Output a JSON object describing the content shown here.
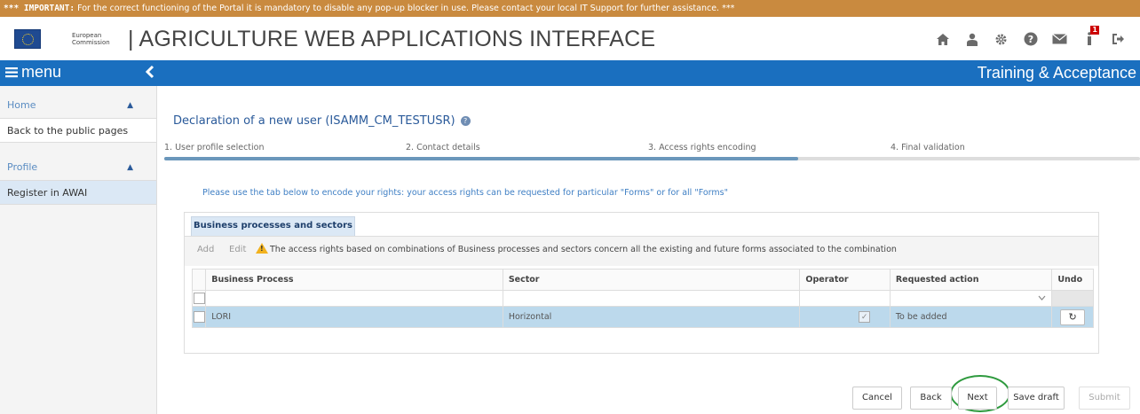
{
  "banner": {
    "label": "*** IMPORTANT:",
    "text": "For the correct functioning of the Portal it is mandatory to disable any pop-up blocker in use. Please contact your local IT Support for further assistance. ***"
  },
  "header": {
    "ec_line1": "European",
    "ec_line2": "Commission",
    "app_title": "| AGRICULTURE WEB APPLICATIONS INTERFACE",
    "notification_count": "1",
    "icons": [
      "home-icon",
      "user-icon",
      "gear-icon",
      "help-icon",
      "mail-icon",
      "notification-icon",
      "logout-icon"
    ]
  },
  "navbar": {
    "menu_label": "menu",
    "environment": "Training & Acceptance"
  },
  "sidebar": {
    "sections": [
      {
        "label": "Home",
        "items": [
          {
            "label": "Back to the public pages",
            "active": false
          }
        ]
      },
      {
        "label": "Profile",
        "items": [
          {
            "label": "Register in AWAI",
            "active": true
          }
        ]
      }
    ]
  },
  "page": {
    "title": "Declaration of a new user (ISAMM_CM_TESTUSR)",
    "steps": [
      "1. User profile selection",
      "2. Contact details",
      "3. Access rights encoding",
      "4. Final validation"
    ],
    "current_step": 3,
    "instruction": "Please use the tab below to encode your rights: your access rights can be requested for particular \"Forms\" or for all \"Forms\""
  },
  "panel": {
    "tab_label": "Business processes and sectors",
    "toolbar": {
      "add_label": "Add",
      "edit_label": "Edit",
      "message": "The access rights based on combinations of Business processes and sectors concern all the existing and future forms associated to the combination"
    },
    "table": {
      "headers": [
        "Business Process",
        "Sector",
        "Operator",
        "Requested action",
        "Undo"
      ],
      "rows": [
        {
          "business_process": "LORI",
          "sector": "Horizontal",
          "operator": true,
          "requested_action": "To be added"
        }
      ]
    }
  },
  "actions": {
    "cancel": "Cancel",
    "back": "Back",
    "next": "Next",
    "save_draft": "Save draft",
    "submit": "Submit"
  },
  "colors": {
    "banner": "#c98a3f",
    "navbar": "#1a6fbf",
    "selected_row": "#bcd9ec",
    "highlight_ring": "#2e9a3e"
  }
}
